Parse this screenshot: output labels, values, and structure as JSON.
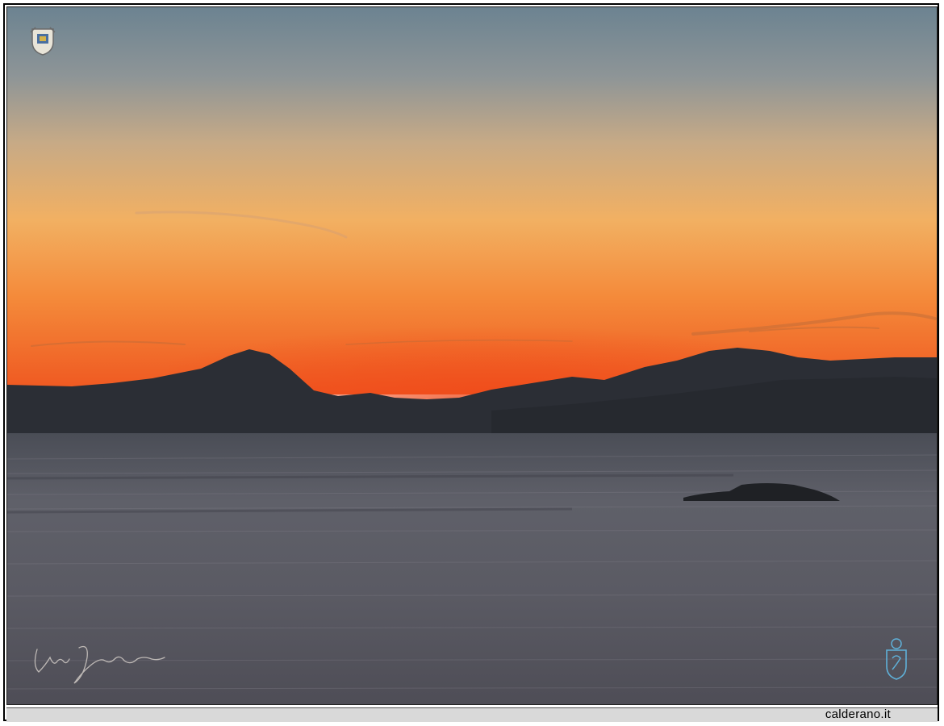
{
  "photo": {
    "subject": "sunset",
    "colors": {
      "sky_top": "#6f8592",
      "sky_mid": "#c9a77f",
      "sky_glow": "#f6a24a",
      "horizon": "#f05a22",
      "mountains": "#2a2d33",
      "sea": "#595a63"
    }
  },
  "watermarks": {
    "top_left_icon": "coat-of-arms-icon",
    "bottom_right_icon": "crest-icon",
    "signature": "handwritten-signature"
  },
  "caption": {
    "site": "calderano.it"
  }
}
